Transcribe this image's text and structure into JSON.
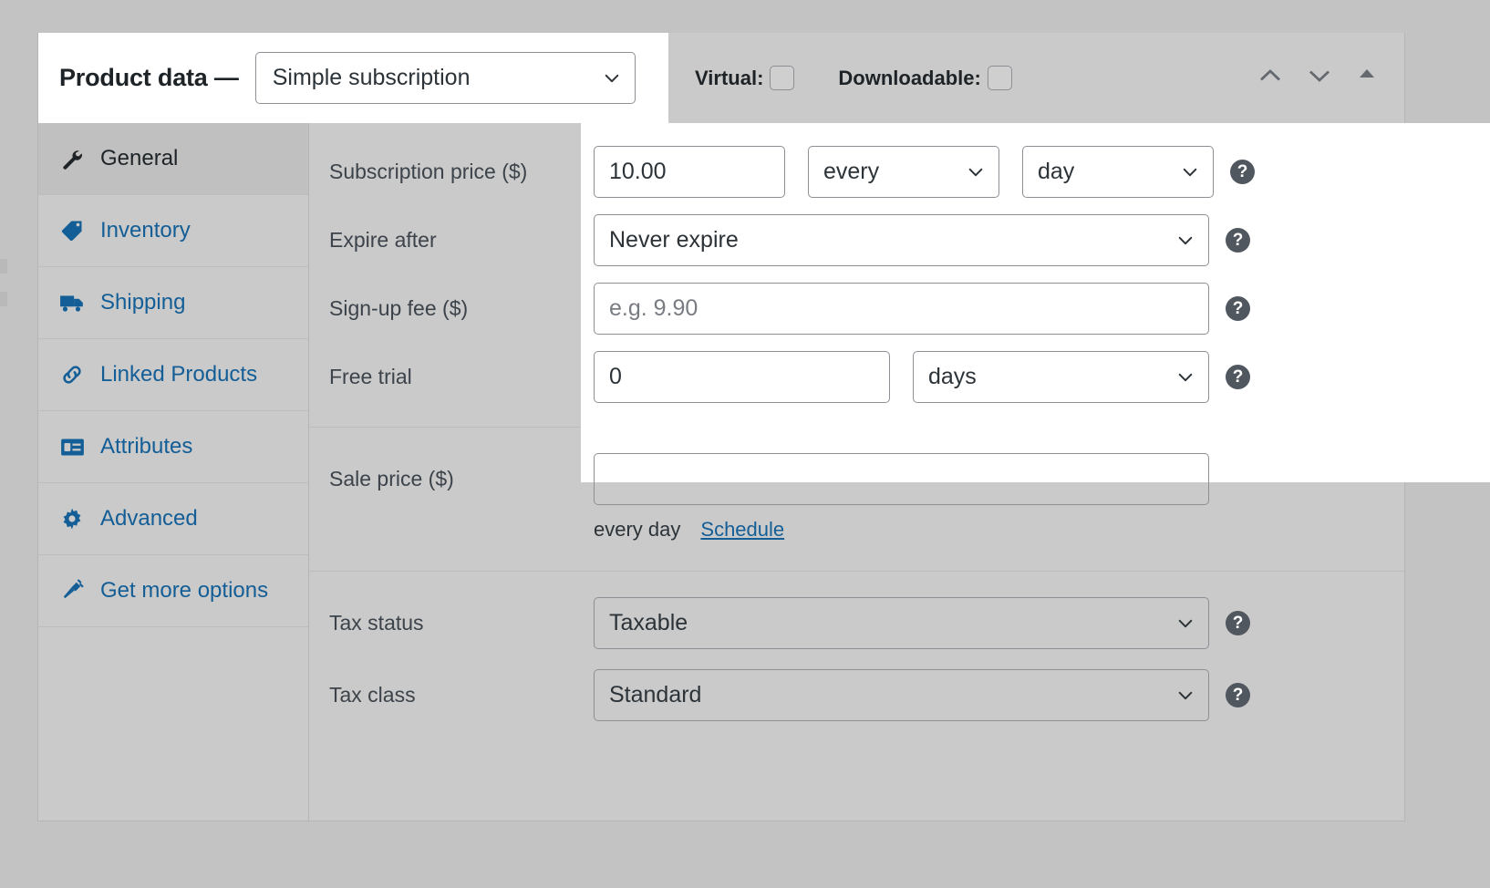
{
  "header": {
    "title": "Product data —",
    "product_type": "Simple subscription",
    "virtual_label": "Virtual:",
    "virtual_checked": false,
    "downloadable_label": "Downloadable:",
    "downloadable_checked": false,
    "move_up_icon": "chevron-up-icon",
    "move_down_icon": "chevron-down-icon",
    "collapse_icon": "triangle-up-icon"
  },
  "tabs": [
    {
      "label": "General",
      "icon": "wrench-icon",
      "active": true
    },
    {
      "label": "Inventory",
      "icon": "tag-icon",
      "active": false
    },
    {
      "label": "Shipping",
      "icon": "truck-icon",
      "active": false
    },
    {
      "label": "Linked Products",
      "icon": "link-icon",
      "active": false
    },
    {
      "label": "Attributes",
      "icon": "attributes-icon",
      "active": false
    },
    {
      "label": "Advanced",
      "icon": "gear-icon",
      "active": false
    },
    {
      "label": "Get more options",
      "icon": "plug-icon",
      "active": false
    }
  ],
  "fields": {
    "subscription_price": {
      "label": "Subscription price ($)",
      "value": "10.00",
      "interval": "every",
      "period": "day",
      "help": "?"
    },
    "expire_after": {
      "label": "Expire after",
      "value": "Never expire",
      "help": "?"
    },
    "signup_fee": {
      "label": "Sign-up fee ($)",
      "value": "",
      "placeholder": "e.g. 9.90",
      "help": "?"
    },
    "free_trial": {
      "label": "Free trial",
      "value": "0",
      "unit": "days",
      "help": "?"
    },
    "sale_price": {
      "label": "Sale price ($)",
      "value": "",
      "note": "every day",
      "schedule_link": "Schedule"
    },
    "tax_status": {
      "label": "Tax status",
      "value": "Taxable",
      "help": "?"
    },
    "tax_class": {
      "label": "Tax class",
      "value": "Standard",
      "help": "?"
    }
  },
  "colors": {
    "link": "#135e96",
    "panel_bg": "#cacaca",
    "page_bg": "#c3c3c3",
    "text": "#1d2327",
    "help_bg": "#50575e"
  }
}
